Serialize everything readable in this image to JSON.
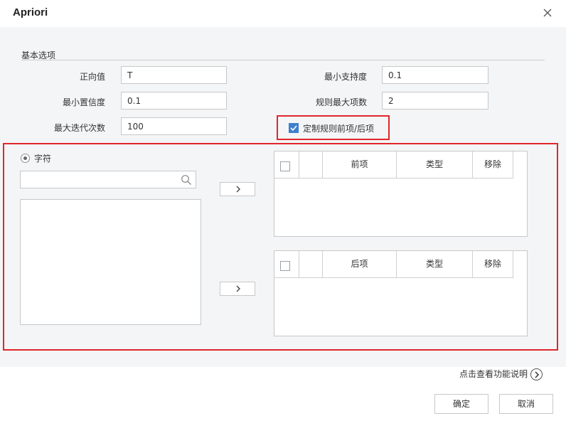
{
  "dialog": {
    "title": "Apriori"
  },
  "basic": {
    "section_label": "基本选项",
    "positive_label": "正向值",
    "positive_value": "T",
    "min_support_label": "最小支持度",
    "min_support_value": "0.1",
    "min_confidence_label": "最小置信度",
    "min_confidence_value": "0.1",
    "max_rule_items_label": "规则最大项数",
    "max_rule_items_value": "2",
    "max_iterations_label": "最大迭代次数",
    "max_iterations_value": "100",
    "custom_rule_label": "定制规则前项/后项",
    "custom_rule_checked": true
  },
  "fields": {
    "radio_label": "字符",
    "search_placeholder": ""
  },
  "antecedent_table": {
    "columns": [
      "",
      "前项",
      "类型",
      "移除"
    ]
  },
  "consequent_table": {
    "columns": [
      "",
      "后项",
      "类型",
      "移除"
    ]
  },
  "footer": {
    "help_text": "点击查看功能说明",
    "ok_label": "确定",
    "cancel_label": "取消"
  },
  "colors": {
    "highlight": "#e0262b",
    "checkbox": "#3d80cf"
  }
}
